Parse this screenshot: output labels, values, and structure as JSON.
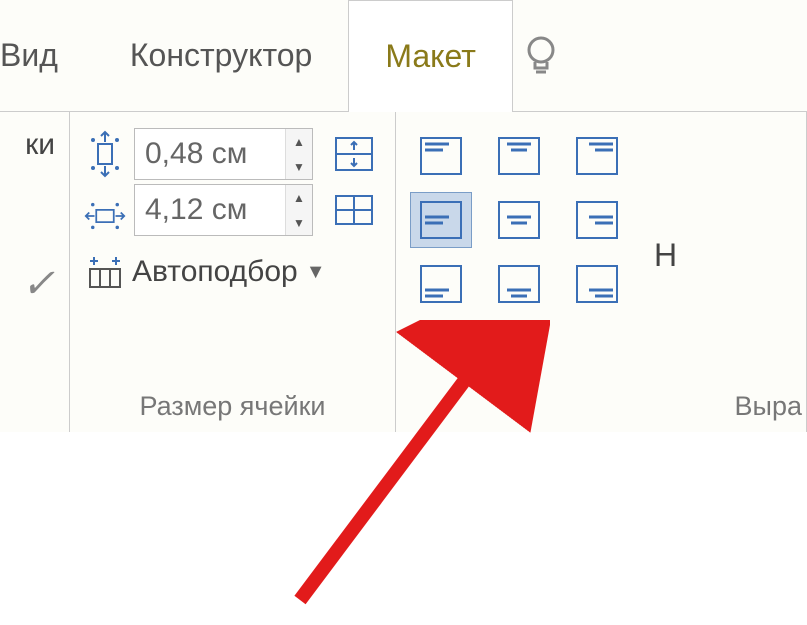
{
  "tabs": {
    "view": "Вид",
    "design": "Конструктор",
    "layout": "Макет"
  },
  "left_partial": {
    "line1": "ки"
  },
  "cell_size": {
    "height_value": "0,48 см",
    "width_value": "4,12 см",
    "autofit_label": "Автоподбор",
    "group_label": "Размер ячейки"
  },
  "alignment": {
    "group_label": "Выра",
    "extra_text": "Н"
  },
  "icons": {
    "height": "height-arrows-icon",
    "width": "width-arrows-icon",
    "autofit": "autofit-icon",
    "dist_rows": "distribute-rows-icon",
    "dist_cols": "distribute-columns-icon"
  }
}
